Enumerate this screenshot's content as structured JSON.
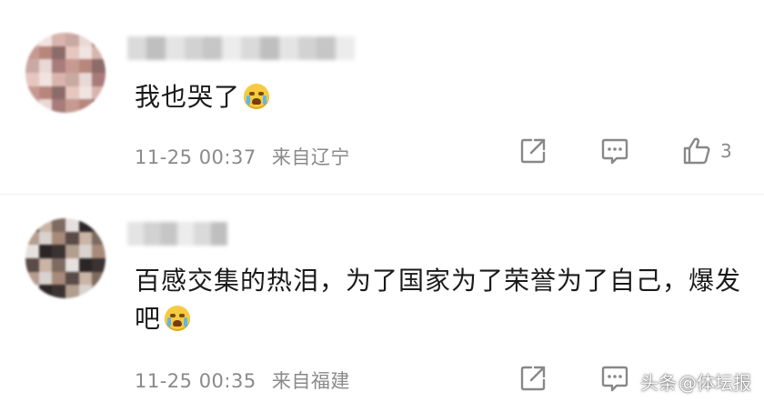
{
  "comments": [
    {
      "text": "我也哭了",
      "emoji": "crying-face-emoji",
      "time": "11-25 00:37",
      "location": "来自辽宁",
      "likes": "3"
    },
    {
      "text": "百感交集的热泪，为了国家为了荣誉为了自己，爆发吧",
      "emoji": "crying-face-emoji",
      "time": "11-25 00:35",
      "location": "来自福建",
      "likes": ""
    }
  ],
  "watermark": {
    "brand": "头条",
    "handle": "@体坛报"
  },
  "colors": {
    "text": "#1a1a1a",
    "meta": "#8a8a8a",
    "icon": "#888888",
    "background": "#ffffff"
  },
  "icons": [
    "share-icon",
    "comment-icon",
    "like-icon"
  ]
}
